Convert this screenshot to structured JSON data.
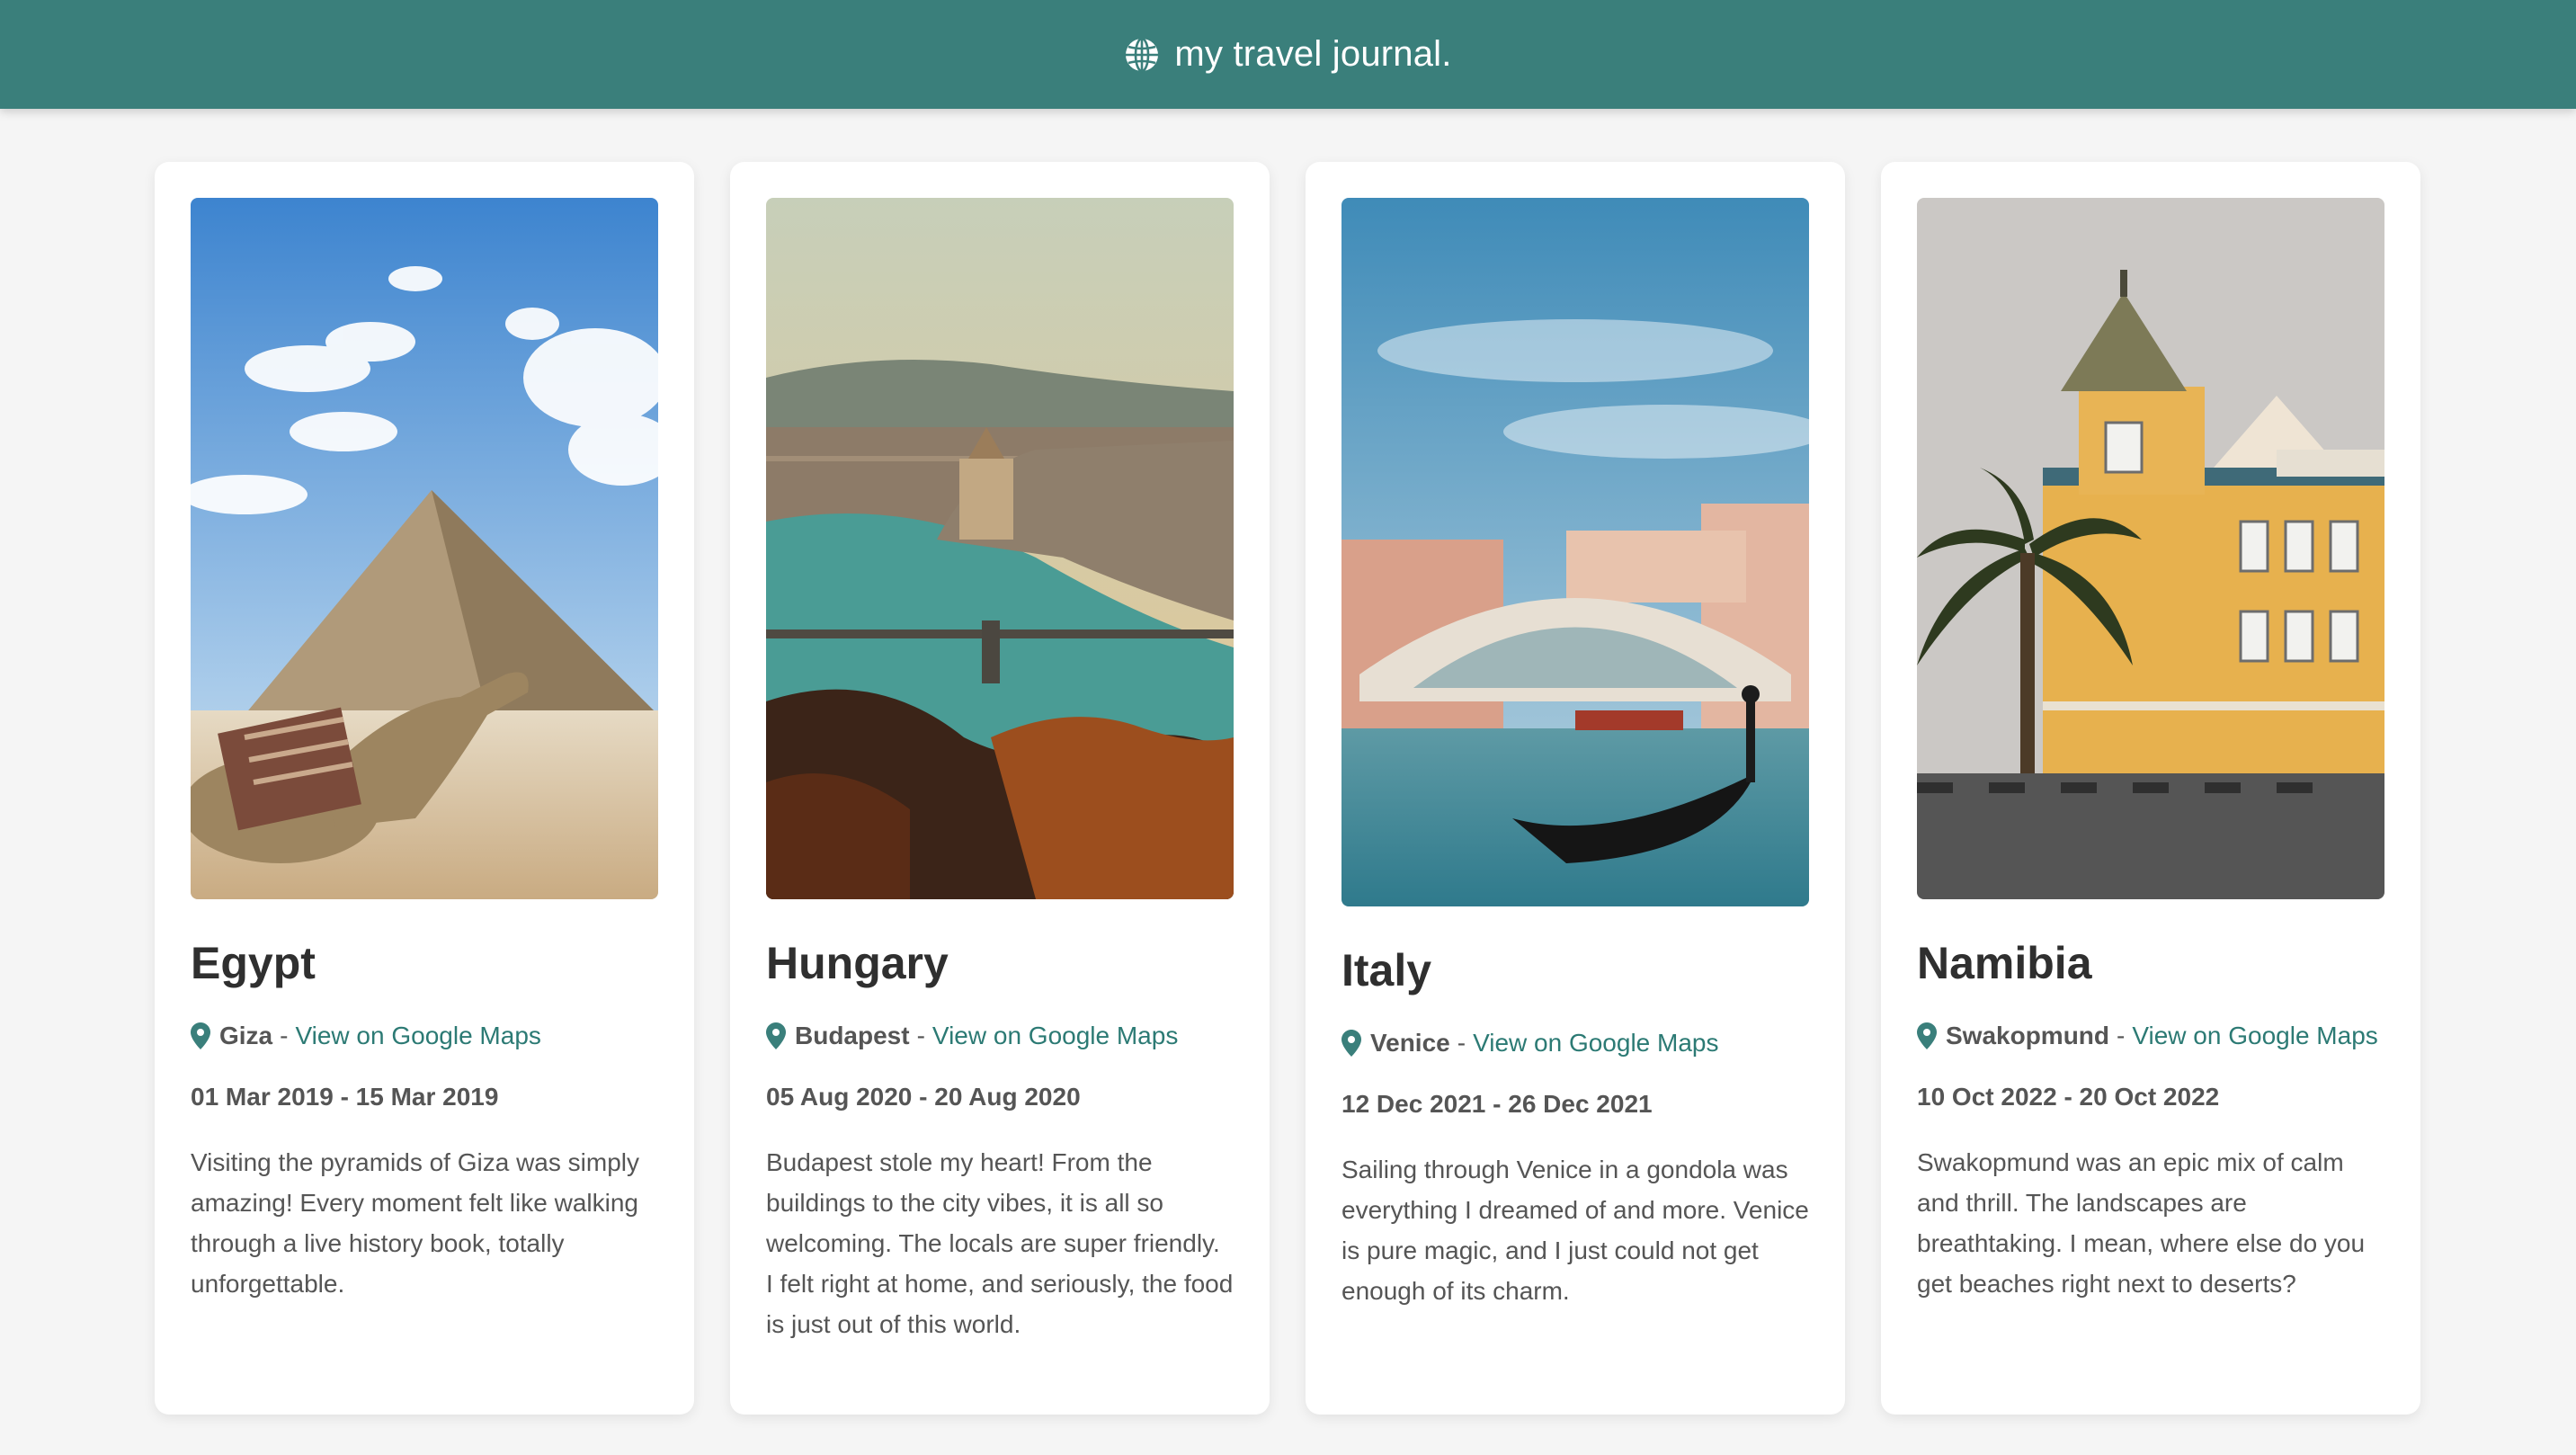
{
  "header": {
    "title": "my travel journal.",
    "icon": "globe-icon"
  },
  "colors": {
    "header_bg": "#3a7f7b",
    "link": "#2c7a74",
    "page_bg": "#f5f5f5"
  },
  "entries": [
    {
      "country": "Egypt",
      "city": "Giza",
      "separator": "-",
      "maps_link": "View on Google Maps",
      "dates": "01 Mar 2019 - 15 Mar 2019",
      "description": "Visiting the pyramids of Giza was simply amazing! Every moment felt like walking through a live history book, totally unforgettable."
    },
    {
      "country": "Hungary",
      "city": "Budapest",
      "separator": "-",
      "maps_link": "View on Google Maps",
      "dates": "05 Aug 2020 - 20 Aug 2020",
      "description": "Budapest stole my heart! From the buildings to the city vibes, it is all so welcoming. The locals are super friendly. I felt right at home, and seriously, the food is just out of this world."
    },
    {
      "country": "Italy",
      "city": "Venice",
      "separator": "-",
      "maps_link": "View on Google Maps",
      "dates": "12 Dec 2021 - 26 Dec 2021",
      "description": "Sailing through Venice in a gondola was everything I dreamed of and more. Venice is pure magic, and I just could not get enough of its charm."
    },
    {
      "country": "Namibia",
      "city": "Swakopmund",
      "separator": "-",
      "maps_link": "View on Google Maps",
      "dates": "10 Oct 2022 - 20 Oct 2022",
      "description": "Swakopmund was an epic mix of calm and thrill. The landscapes are breathtaking. I mean, where else do you get beaches right next to deserts?"
    }
  ]
}
